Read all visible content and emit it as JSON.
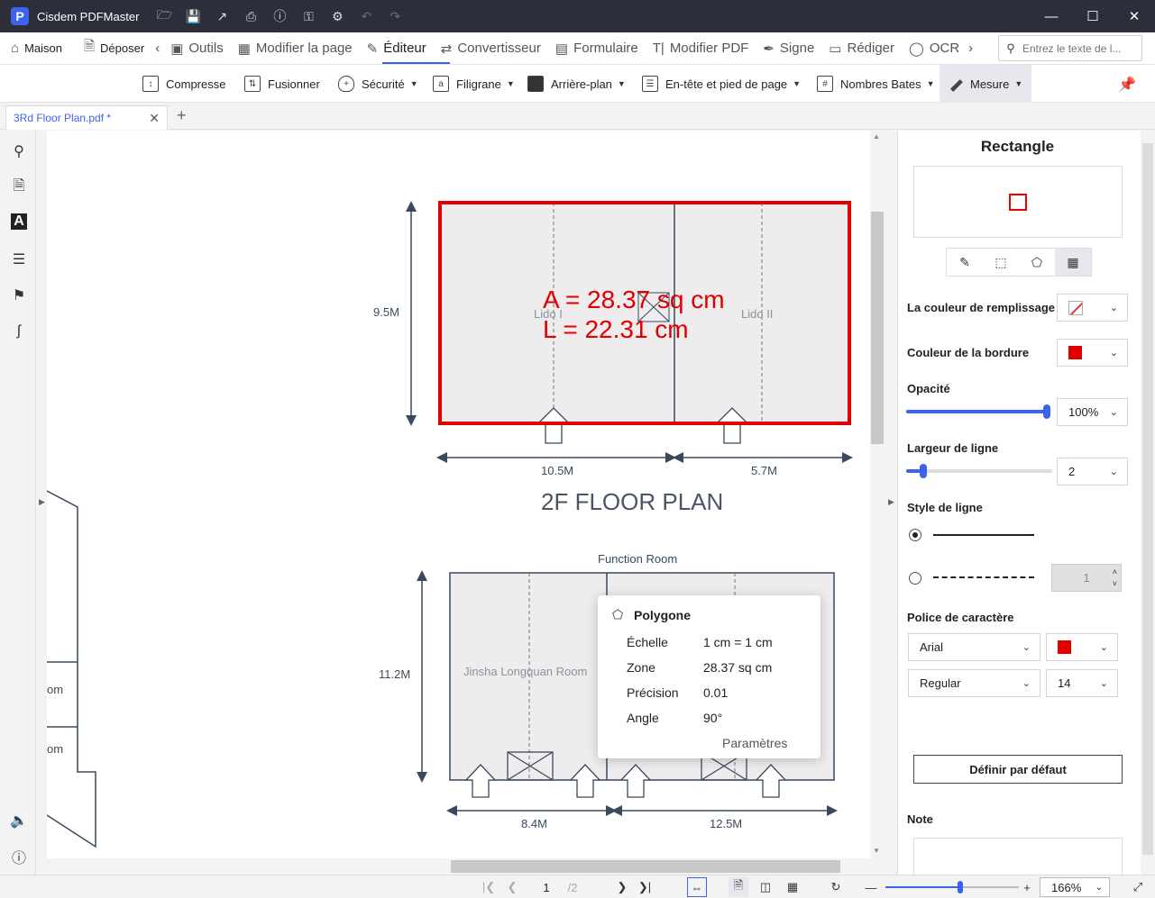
{
  "app": {
    "logo_letter": "P",
    "name": "Cisdem PDFMaster",
    "toolbar_icons": [
      "open-folder-icon",
      "save-icon",
      "share-icon",
      "print-icon",
      "help-icon",
      "key-icon",
      "settings-icon",
      "undo-icon",
      "redo-icon"
    ]
  },
  "menu": {
    "home": "Maison",
    "upload": "Déposer",
    "tools": "Outils",
    "edit_page": "Modifier la page",
    "editor": "Éditeur",
    "converter": "Convertisseur",
    "form": "Formulaire",
    "edit_pdf": "Modifier PDF",
    "sign": "Signe",
    "redact": "Rédiger",
    "ocr": "OCR",
    "search_placeholder": "Entrez le texte de l..."
  },
  "subtoolbar": {
    "compress": "Compresse",
    "merge": "Fusionner",
    "security": "Sécurité",
    "watermark": "Filigrane",
    "background": "Arrière-plan",
    "header_footer": "En-tête et pied de page",
    "bates": "Nombres Bates",
    "measure": "Mesure"
  },
  "tab": {
    "title": "3Rd Floor Plan.pdf *"
  },
  "document": {
    "measure_area": "A = 28.37 sq cm",
    "measure_length": "L = 22.31 cm",
    "room_left": "Lido I",
    "room_right": "Lido II",
    "height_top": "9.5M",
    "width_top_left": "10.5M",
    "width_top_right": "5.7M",
    "plan_title": "2F FLOOR PLAN",
    "function_room": "Function Room",
    "height_bottom": "11.2M",
    "room_bottom_left": "Jinsha Longquan Room",
    "width_bottom_left": "8.4M",
    "width_bottom_right": "12.5M",
    "partial_label_1": "om",
    "partial_label_2": "om"
  },
  "popup": {
    "title": "Polygone",
    "scale_label": "Échelle",
    "scale_value": "1 cm = 1 cm",
    "zone_label": "Zone",
    "zone_value": "28.37 sq cm",
    "precision_label": "Précision",
    "precision_value": "0.01",
    "angle_label": "Angle",
    "angle_value": "90°",
    "settings_link": "Paramètres"
  },
  "panel": {
    "title": "Rectangle",
    "fill_color_label": "La couleur de remplissage",
    "border_color_label": "Couleur de la bordure",
    "border_color": "#e00000",
    "opacity_label": "Opacité",
    "opacity_value": "100%",
    "opacity_fraction": 1.0,
    "line_width_label": "Largeur de ligne",
    "line_width_value": "2",
    "line_style_label": "Style de ligne",
    "dash_value": "1",
    "font_label": "Police de caractère",
    "font_family": "Arial",
    "font_color": "#e00000",
    "font_style": "Regular",
    "font_size": "14",
    "default_button": "Définir par défaut",
    "note_label": "Note"
  },
  "status": {
    "page_current": "1",
    "page_total": "/2",
    "zoom": "166%"
  }
}
